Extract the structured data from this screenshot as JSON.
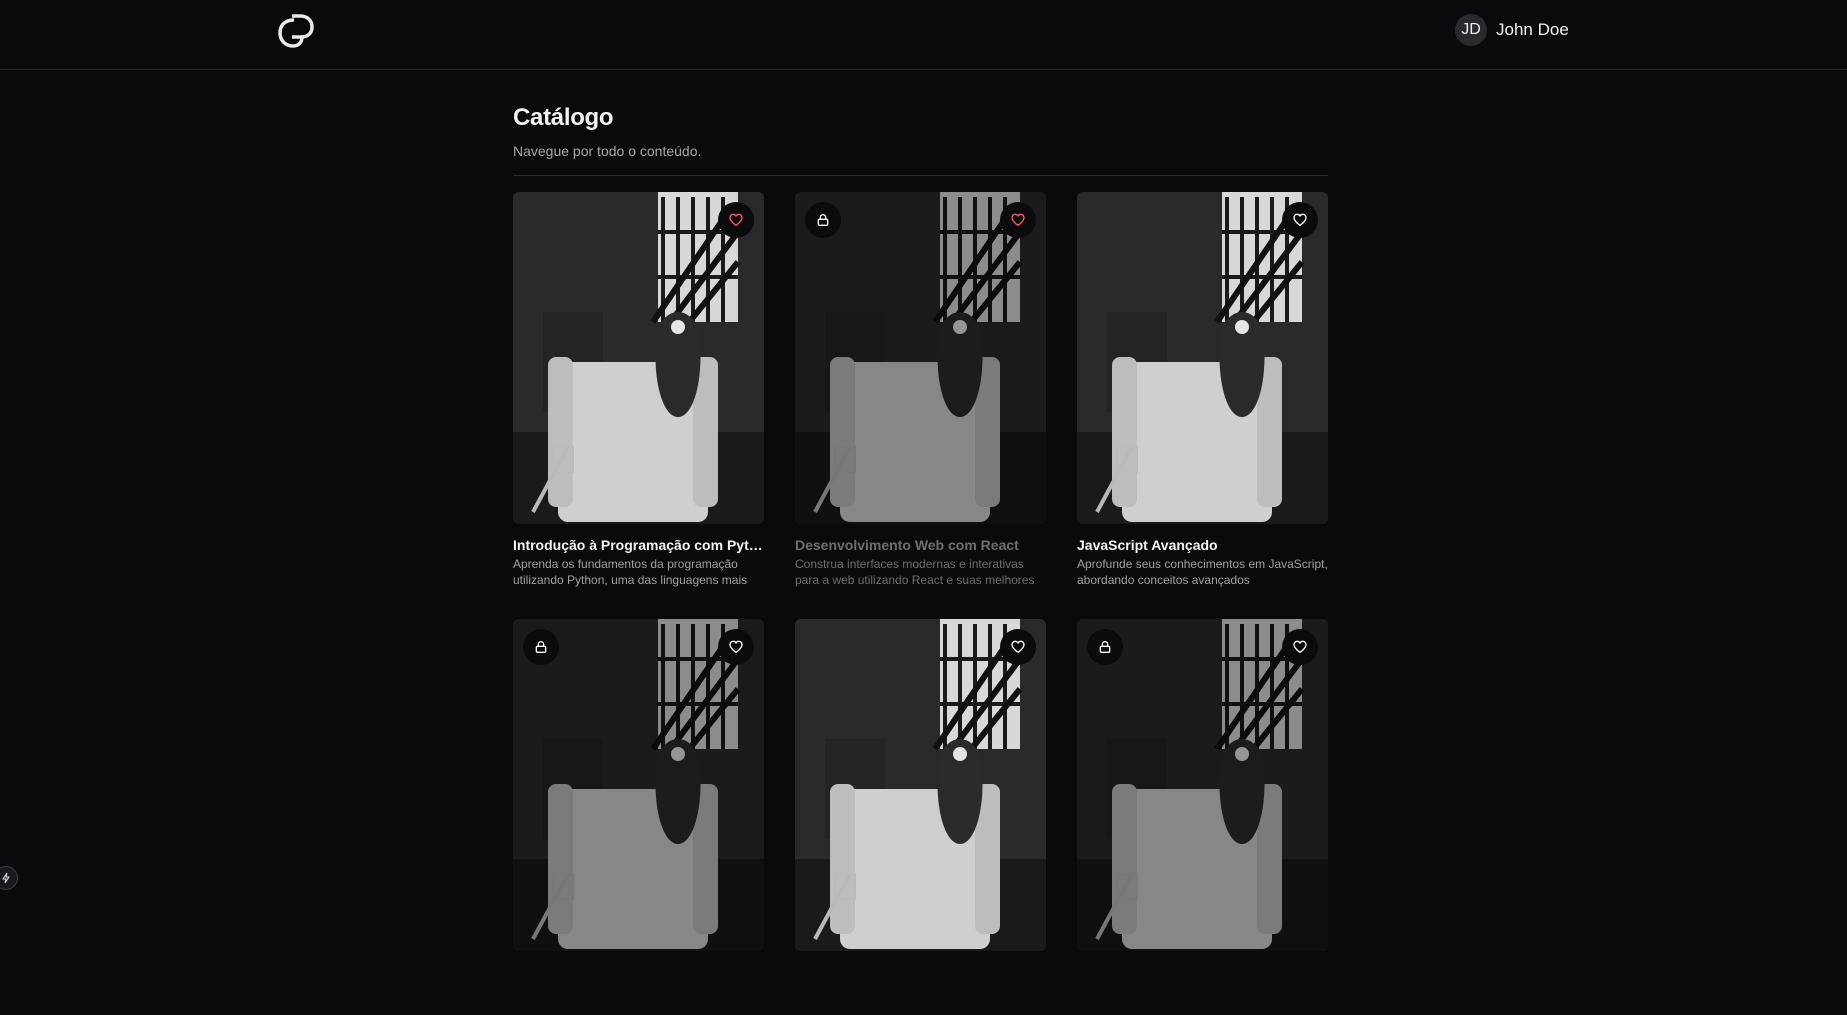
{
  "header": {
    "logo_icon": "gd-monogram-logo",
    "user": {
      "initials": "JD",
      "name": "John Doe"
    }
  },
  "page": {
    "title": "Catálogo",
    "subtitle": "Navegue por todo o conteúdo."
  },
  "colors": {
    "background": "#0a0a0c",
    "favorite_active": "#ff5a5f",
    "favorite_inactive": "#ffffff"
  },
  "cards": [
    {
      "title": "Introdução à Programação com Python",
      "description": "Aprenda os fundamentos da programação utilizando Python, uma das linguagens mais populares",
      "locked": false,
      "favorited": true,
      "icons": [
        "heart-icon"
      ]
    },
    {
      "title": "Desenvolvimento Web com React",
      "description": "Construa interfaces modernas e interativas para a web utilizando React e suas melhores práticas",
      "locked": true,
      "favorited": true,
      "icons": [
        "lock-icon",
        "heart-icon"
      ]
    },
    {
      "title": "JavaScript Avançado",
      "description": "Aprofunde seus conhecimentos em JavaScript, abordando conceitos avançados",
      "locked": false,
      "favorited": false,
      "icons": [
        "heart-icon"
      ]
    },
    {
      "title": "",
      "description": "",
      "locked": true,
      "favorited": false,
      "icons": [
        "lock-icon",
        "heart-icon"
      ]
    },
    {
      "title": "",
      "description": "",
      "locked": false,
      "favorited": false,
      "icons": [
        "heart-icon"
      ]
    },
    {
      "title": "",
      "description": "",
      "locked": true,
      "favorited": false,
      "icons": [
        "lock-icon",
        "heart-icon"
      ]
    }
  ],
  "footer": {
    "corner_icon": "bolt-icon"
  }
}
